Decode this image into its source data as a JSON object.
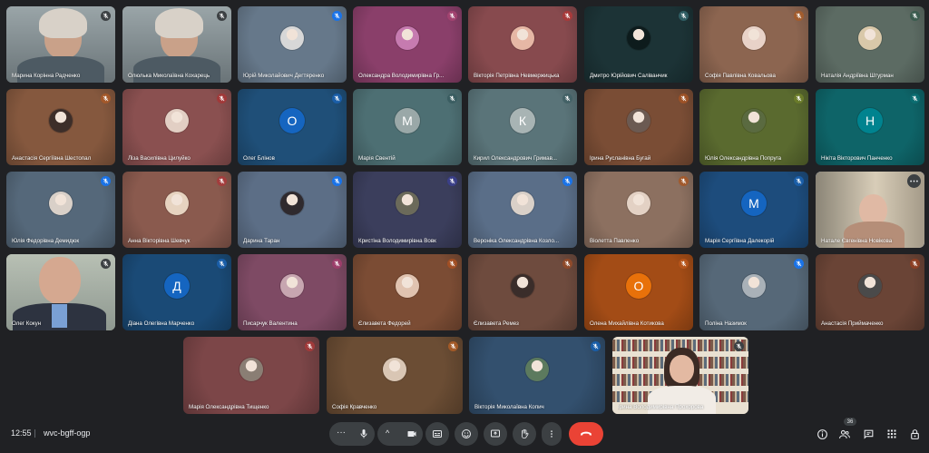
{
  "meeting": {
    "time": "12:55",
    "code": "wvc-bgff-ogp",
    "participant_count": "36"
  },
  "colors": {
    "accent": "#8ab4f8",
    "end_call": "#ea4335",
    "bar_button": "#3c4043"
  },
  "participants": [
    {
      "name": "Марина Корінна Радченко",
      "type": "video",
      "bg": "#7e8a8f",
      "mute": "#3c4043"
    },
    {
      "name": "Олюлька Миколаївна Кохарець",
      "type": "video",
      "bg": "#8c7f70",
      "mute": "#3c4043"
    },
    {
      "name": "Юрій Миколайович Дегтяренко",
      "type": "avatar",
      "bg": "#66788a",
      "avatar": "#d7d7d7",
      "mute": "#1a73e8"
    },
    {
      "name": "Олександра Володимирівна Гр...",
      "type": "avatar",
      "bg": "#8a3f6a",
      "avatar": "#c67bb0",
      "mute": "#a1426f"
    },
    {
      "name": "Вікторія Петрівна Невмержицька",
      "type": "avatar",
      "bg": "#874a4e",
      "avatar": "#e6b7a5",
      "mute": "#a83a3a"
    },
    {
      "name": "Дмитро Юрійович Саліванчик",
      "type": "avatar",
      "bg": "#1c3336",
      "avatar": "#0d1b1c",
      "mute": "#2f5d63"
    },
    {
      "name": "Софія Павлівна Ковальова",
      "type": "avatar",
      "bg": "#8c6550",
      "avatar": "#e8d2c8",
      "mute": "#a25c2d"
    },
    {
      "name": "Наталія Андріївна Штурман",
      "type": "avatar",
      "bg": "#5c6b63",
      "avatar": "#d9c8a9",
      "mute": "#3b5c4f"
    },
    {
      "name": "Анастасія Сергіївна Шестопал",
      "type": "avatar",
      "bg": "#85583e",
      "avatar": "#3d2e29",
      "mute": "#a3582a"
    },
    {
      "name": "Ліза Василівна Цилуйко",
      "type": "avatar",
      "bg": "#8a5050",
      "avatar": "#e2cfc4",
      "mute": "#a13939"
    },
    {
      "name": "Олег Блінов",
      "type": "letter",
      "letter": "О",
      "bg": "#1f4f78",
      "avatar": "#1565c0",
      "mute": "#1a5ea8"
    },
    {
      "name": "Марія Свентій",
      "type": "letter",
      "letter": "М",
      "bg": "#4d6f73",
      "avatar": "#9aa8a8",
      "mute": "#3a5d61"
    },
    {
      "name": "Кирил Олександрович Гримав...",
      "type": "letter",
      "letter": "К",
      "bg": "#5a7479",
      "avatar": "#a8b4b4",
      "mute": "#436166"
    },
    {
      "name": "Ірина Русланівна Бугай",
      "type": "avatar",
      "bg": "#7a4d35",
      "avatar": "#6b5a52",
      "mute": "#9d5227"
    },
    {
      "name": "Юлія Олександрівна Попруга",
      "type": "avatar",
      "bg": "#5a6a2f",
      "avatar": "#5a6a40",
      "mute": "#6a7b2a"
    },
    {
      "name": "Нікіта Вікторович Панченко",
      "type": "letter",
      "letter": "Н",
      "bg": "#0e6468",
      "avatar": "#00838f",
      "mute": "#0b6c70"
    },
    {
      "name": "Юлія Федорівна Демидюк",
      "type": "avatar",
      "bg": "#55687a",
      "avatar": "#d9d0c8",
      "mute": "#1a73e8"
    },
    {
      "name": "Анна Вікторівна Шевчук",
      "type": "avatar",
      "bg": "#8a5a4e",
      "avatar": "#e6d3c0",
      "mute": "#a33d3d"
    },
    {
      "name": "Дарина Таран",
      "type": "avatar",
      "bg": "#5c6e86",
      "avatar": "#2f2a2e",
      "mute": "#1a73e8"
    },
    {
      "name": "Кристіна Володимирівна Вовк",
      "type": "avatar",
      "bg": "#3b3e5c",
      "avatar": "#6b6a5a",
      "mute": "#3a3f88"
    },
    {
      "name": "Вероніка Олександрівна Козло...",
      "type": "avatar",
      "bg": "#5a6e88",
      "avatar": "#d9d0c8",
      "mute": "#1a73e8"
    },
    {
      "name": "Віолетта Павленко",
      "type": "avatar",
      "bg": "#8c7060",
      "avatar": "#e3d1c4",
      "mute": "#a15a2d"
    },
    {
      "name": "Марія Сергіївна Далекорій",
      "type": "letter",
      "letter": "М",
      "bg": "#1d4c7c",
      "avatar": "#1565c0",
      "mute": "#1a5ea8"
    },
    {
      "name": "Натале Євгенівна Новікова",
      "type": "video-speaker",
      "bg": "#c8b9a0",
      "mute": "#3c4043"
    },
    {
      "name": "Олег Кокун",
      "type": "video-man",
      "bg": "#a9b4a8",
      "mute": "#3c4043"
    },
    {
      "name": "Діана Олегівна Марченко",
      "type": "letter",
      "letter": "Д",
      "bg": "#1a4a76",
      "avatar": "#1565c0",
      "mute": "#1a5ea8"
    },
    {
      "name": "Писарчук Валентина",
      "type": "avatar",
      "bg": "#7e4a64",
      "avatar": "#c7a6b0",
      "mute": "#9c3e6a"
    },
    {
      "name": "Єлизавета Федорей",
      "type": "avatar",
      "bg": "#7b4c34",
      "avatar": "#e0c3b0",
      "mute": "#a14f24"
    },
    {
      "name": "Єлизавета Ремез",
      "type": "avatar",
      "bg": "#6e4b3e",
      "avatar": "#3a2d2a",
      "mute": "#8f4a2a"
    },
    {
      "name": "Олена Михайлівна Котикова",
      "type": "letter",
      "letter": "О",
      "bg": "#a34c16",
      "avatar": "#e8710a",
      "mute": "#b5541a"
    },
    {
      "name": "Поліна Назимок",
      "type": "avatar",
      "bg": "#566878",
      "avatar": "#a9b1b8",
      "mute": "#1a73e8"
    },
    {
      "name": "Анастасія Приймаченко",
      "type": "avatar",
      "bg": "#6a4436",
      "avatar": "#4a4a4a",
      "mute": "#8c3f24"
    },
    {
      "name": "Марія Олександрівна Тищенко",
      "type": "avatar",
      "bg": "#7c4648",
      "avatar": "#8a7e74",
      "mute": "#a13a3a"
    },
    {
      "name": "Софія Кравченко",
      "type": "avatar",
      "bg": "#6b4d34",
      "avatar": "#d9c6b4",
      "mute": "#a35a27"
    },
    {
      "name": "Вікторія Миколаївна Копич",
      "type": "avatar",
      "bg": "#33506e",
      "avatar": "#5c7a5e",
      "mute": "#1a5ea8"
    },
    {
      "name": "Ірина Володимирівна Прохорова",
      "type": "video-bookshelf",
      "bg": "#d9cfc0",
      "mute": "#3c4043"
    }
  ],
  "controls": {
    "mic_icon": "microphone-icon",
    "camera_icon": "camera-icon",
    "captions_icon": "captions-icon",
    "emoji_icon": "emoji-icon",
    "present_icon": "present-screen-icon",
    "hand_icon": "raise-hand-icon",
    "more_icon": "more-vert-icon",
    "end_icon": "end-call-icon",
    "info_icon": "info-icon",
    "people_icon": "people-icon",
    "chat_icon": "chat-icon",
    "activities_icon": "activities-icon",
    "lock_icon": "host-controls-icon"
  }
}
